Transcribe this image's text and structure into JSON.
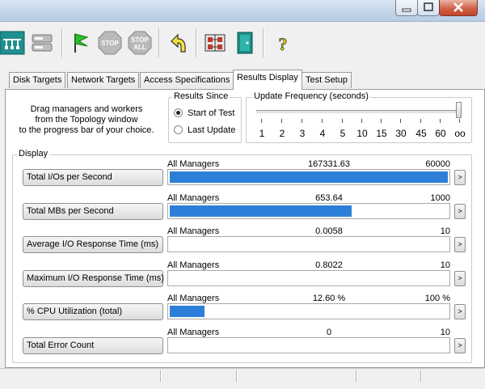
{
  "window": {
    "minimize_glyph": "–",
    "maximize_glyph": "□",
    "close_glyph": "x"
  },
  "toolbar": {
    "icons": [
      "topology-icon",
      "disk-icon",
      "start-flag-icon",
      "stop-icon",
      "stop-all-icon",
      "reset-workers-icon",
      "config-icon",
      "exit-icon",
      "help-icon"
    ],
    "stop_label": "STOP",
    "stop_all_label_1": "STOP",
    "stop_all_label_2": "ALL"
  },
  "tabs": [
    "Disk Targets",
    "Network Targets",
    "Access Specifications",
    "Results Display",
    "Test Setup"
  ],
  "active_tab": "Results Display",
  "drag_hint": [
    "Drag managers and workers",
    "from the Topology window",
    "to the progress bar of your choice."
  ],
  "results_since": {
    "title": "Results Since",
    "options": [
      "Start of Test",
      "Last Update"
    ],
    "selected": "Start of Test"
  },
  "update_frequency": {
    "title": "Update Frequency (seconds)",
    "ticks": [
      "1",
      "2",
      "3",
      "4",
      "5",
      "10",
      "15",
      "30",
      "45",
      "60",
      "oo"
    ],
    "selected": "oo"
  },
  "display": {
    "title": "Display",
    "rows": [
      {
        "button": "Total I/Os per Second",
        "source": "All Managers",
        "value": "167331.63",
        "max": "60000",
        "fill_fraction": 1.0,
        "more": ">"
      },
      {
        "button": "Total MBs per Second",
        "source": "All Managers",
        "value": "653.64",
        "max": "1000",
        "fill_fraction": 0.654,
        "more": ">"
      },
      {
        "button": "Average I/O Response Time (ms)",
        "source": "All Managers",
        "value": "0.0058",
        "max": "10",
        "fill_fraction": 0.0,
        "more": ">"
      },
      {
        "button": "Maximum I/O Response Time (ms)",
        "source": "All Managers",
        "value": "0.8022",
        "max": "10",
        "fill_fraction": 0.0,
        "more": ">"
      },
      {
        "button": "% CPU Utilization (total)",
        "source": "All Managers",
        "value": "12.60 %",
        "max": "100 %",
        "fill_fraction": 0.126,
        "more": ">"
      },
      {
        "button": "Total Error Count",
        "source": "All Managers",
        "value": "0",
        "max": "10",
        "fill_fraction": 0.0,
        "more": ">"
      }
    ]
  },
  "colors": {
    "bar_fill": "#2c7fd8",
    "panel_bg": "#ffffff",
    "chrome_bg": "#f0f0f0"
  }
}
